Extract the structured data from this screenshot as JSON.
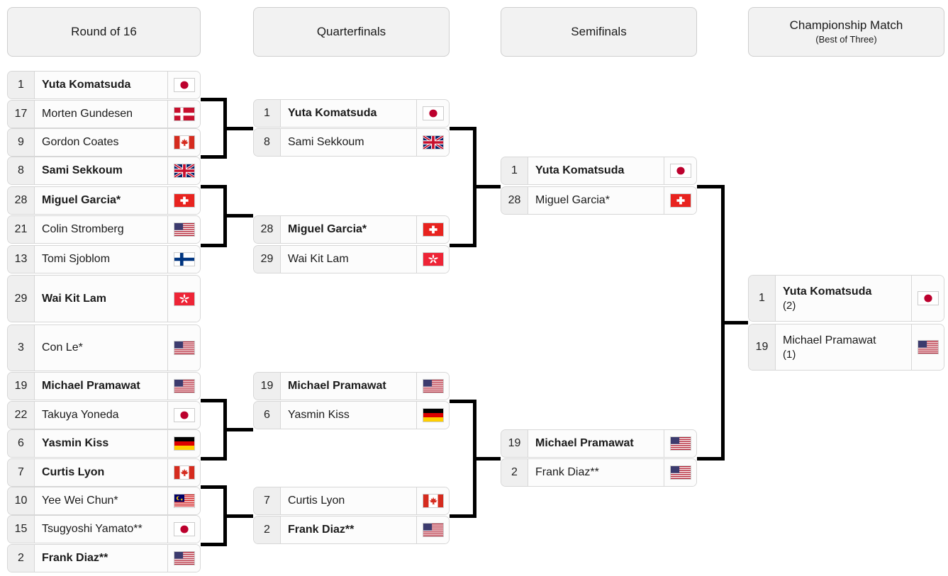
{
  "rounds": [
    {
      "title": "Round of 16",
      "sub": ""
    },
    {
      "title": "Quarterfinals",
      "sub": ""
    },
    {
      "title": "Semifinals",
      "sub": ""
    },
    {
      "title": "Championship Match",
      "sub": "(Best of Three)"
    }
  ],
  "colors": {
    "connector": "#000000",
    "slot_bg": "#fcfcfc",
    "seed_bg": "#efefef",
    "header_bg": "#f2f2f2",
    "border": "#d7d7d7",
    "text": "#1b1b1b"
  },
  "round_of_16": [
    {
      "seed": "1",
      "name": "Yuta Komatsuda",
      "flag": "jp",
      "winner": true,
      "score": ""
    },
    {
      "seed": "17",
      "name": "Morten Gundesen",
      "flag": "dk",
      "winner": false,
      "score": ""
    },
    {
      "seed": "9",
      "name": "Gordon Coates",
      "flag": "ca",
      "winner": false,
      "score": ""
    },
    {
      "seed": "8",
      "name": "Sami Sekkoum",
      "flag": "gb",
      "winner": true,
      "score": ""
    },
    {
      "seed": "28",
      "name": "Miguel Garcia*",
      "flag": "ch",
      "winner": true,
      "score": ""
    },
    {
      "seed": "21",
      "name": "Colin Stromberg",
      "flag": "us",
      "winner": false,
      "score": ""
    },
    {
      "seed": "13",
      "name": "Tomi Sjoblom",
      "flag": "fi",
      "winner": false,
      "score": ""
    },
    {
      "seed": "29",
      "name": "Wai Kit Lam",
      "flag": "hk",
      "winner": true,
      "score": ""
    },
    {
      "seed": "3",
      "name": "Con Le*",
      "flag": "us",
      "winner": false,
      "score": ""
    },
    {
      "seed": "19",
      "name": "Michael Pramawat",
      "flag": "us",
      "winner": true,
      "score": ""
    },
    {
      "seed": "22",
      "name": "Takuya Yoneda",
      "flag": "jp",
      "winner": false,
      "score": ""
    },
    {
      "seed": "6",
      "name": "Yasmin Kiss",
      "flag": "de",
      "winner": true,
      "score": ""
    },
    {
      "seed": "7",
      "name": "Curtis Lyon",
      "flag": "ca",
      "winner": true,
      "score": ""
    },
    {
      "seed": "10",
      "name": "Yee Wei Chun*",
      "flag": "my",
      "winner": false,
      "score": ""
    },
    {
      "seed": "15",
      "name": "Tsugyoshi Yamato**",
      "flag": "jp",
      "winner": false,
      "score": ""
    },
    {
      "seed": "2",
      "name": "Frank Diaz**",
      "flag": "us",
      "winner": true,
      "score": ""
    }
  ],
  "quarterfinals": [
    {
      "seed": "1",
      "name": "Yuta Komatsuda",
      "flag": "jp",
      "winner": true,
      "score": ""
    },
    {
      "seed": "8",
      "name": "Sami Sekkoum",
      "flag": "gb",
      "winner": false,
      "score": ""
    },
    {
      "seed": "28",
      "name": "Miguel Garcia*",
      "flag": "ch",
      "winner": true,
      "score": ""
    },
    {
      "seed": "29",
      "name": "Wai Kit Lam",
      "flag": "hk",
      "winner": false,
      "score": ""
    },
    {
      "seed": "19",
      "name": "Michael Pramawat",
      "flag": "us",
      "winner": true,
      "score": ""
    },
    {
      "seed": "6",
      "name": "Yasmin Kiss",
      "flag": "de",
      "winner": false,
      "score": ""
    },
    {
      "seed": "7",
      "name": "Curtis Lyon",
      "flag": "ca",
      "winner": false,
      "score": ""
    },
    {
      "seed": "2",
      "name": "Frank Diaz**",
      "flag": "us",
      "winner": true,
      "score": ""
    }
  ],
  "semifinals": [
    {
      "seed": "1",
      "name": "Yuta Komatsuda",
      "flag": "jp",
      "winner": true,
      "score": ""
    },
    {
      "seed": "28",
      "name": "Miguel Garcia*",
      "flag": "ch",
      "winner": false,
      "score": ""
    },
    {
      "seed": "19",
      "name": "Michael Pramawat",
      "flag": "us",
      "winner": true,
      "score": ""
    },
    {
      "seed": "2",
      "name": "Frank Diaz**",
      "flag": "us",
      "winner": false,
      "score": ""
    }
  ],
  "championship": [
    {
      "seed": "1",
      "name": "Yuta Komatsuda",
      "flag": "jp",
      "winner": true,
      "score": "(2)"
    },
    {
      "seed": "19",
      "name": "Michael Pramawat",
      "flag": "us",
      "winner": false,
      "score": "(1)"
    }
  ]
}
